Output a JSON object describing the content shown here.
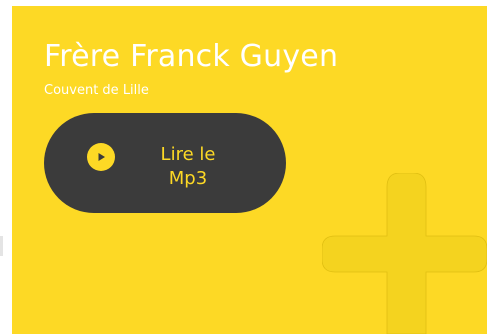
{
  "header": {
    "name": "Frère Franck Guyen",
    "location": "Couvent de Lille"
  },
  "player": {
    "label": "Lire le\nMp3",
    "icon": "play-icon"
  },
  "colors": {
    "background": "#fdd925",
    "button": "#3b3b3b",
    "text": "#ffffff",
    "accent": "#fdd925",
    "cross": "#f4d31f"
  }
}
